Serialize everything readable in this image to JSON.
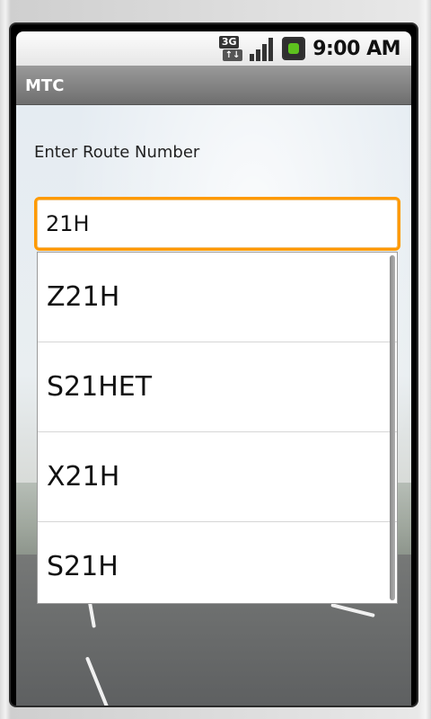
{
  "status_bar": {
    "network_top": "3G",
    "network_bottom": "↑↓",
    "time": "9:00 AM"
  },
  "app": {
    "title": "MTC"
  },
  "form": {
    "prompt": "Enter Route Number",
    "input_value": "21H"
  },
  "suggestions": [
    {
      "label": "Z21H"
    },
    {
      "label": "S21HET"
    },
    {
      "label": "X21H"
    },
    {
      "label": "S21H"
    }
  ],
  "colors": {
    "input_focus": "#ff9a00",
    "battery_charge": "#5dc21e",
    "title_bar": "#7c7c7c"
  },
  "icons": {
    "network": "3g-icon",
    "signal": "signal-bars-icon",
    "battery": "battery-charging-icon"
  }
}
